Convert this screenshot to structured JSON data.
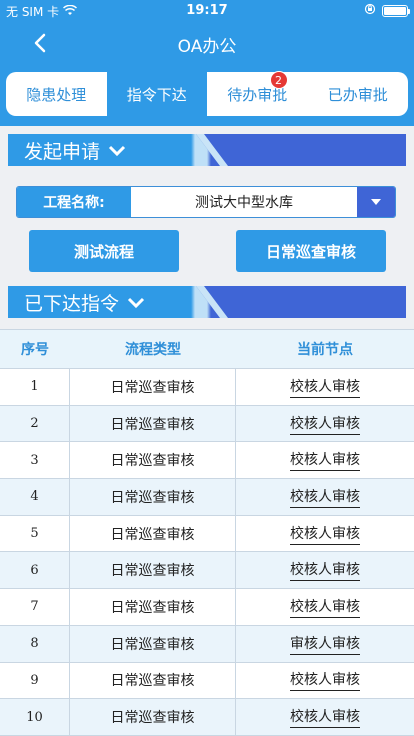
{
  "status_bar": {
    "carrier": "无 SIM 卡",
    "time": "19:17",
    "battery_level": 1.0
  },
  "navbar": {
    "title": "OA办公",
    "back_icon": "chevron-left-icon"
  },
  "tabs": [
    {
      "label": "隐患处理",
      "active": false
    },
    {
      "label": "指令下达",
      "active": true
    },
    {
      "label": "待办审批",
      "active": false,
      "badge": "2"
    },
    {
      "label": "已办审批",
      "active": false
    }
  ],
  "launch_section": {
    "title": "发起申请",
    "project_label": "工程名称:",
    "project_value": "测试大中型水库",
    "buttons": [
      "测试流程",
      "日常巡查审核"
    ]
  },
  "issued_section": {
    "title": "已下达指令"
  },
  "table": {
    "headers": [
      "序号",
      "流程类型",
      "当前节点"
    ],
    "rows": [
      {
        "no": "1",
        "type": "日常巡查审核",
        "node": "校核人审核"
      },
      {
        "no": "2",
        "type": "日常巡查审核",
        "node": "校核人审核"
      },
      {
        "no": "3",
        "type": "日常巡查审核",
        "node": "校核人审核"
      },
      {
        "no": "4",
        "type": "日常巡查审核",
        "node": "校核人审核"
      },
      {
        "no": "5",
        "type": "日常巡查审核",
        "node": "校核人审核"
      },
      {
        "no": "6",
        "type": "日常巡查审核",
        "node": "校核人审核"
      },
      {
        "no": "7",
        "type": "日常巡查审核",
        "node": "校核人审核"
      },
      {
        "no": "8",
        "type": "日常巡查审核",
        "node": "审核人审核"
      },
      {
        "no": "9",
        "type": "日常巡查审核",
        "node": "校核人审核"
      },
      {
        "no": "10",
        "type": "日常巡查审核",
        "node": "校核人审核"
      }
    ]
  },
  "colors": {
    "primary": "#2f9ae6",
    "accent": "#3f65d6",
    "badge": "#e53935",
    "row_alt": "#eaf4fb"
  }
}
